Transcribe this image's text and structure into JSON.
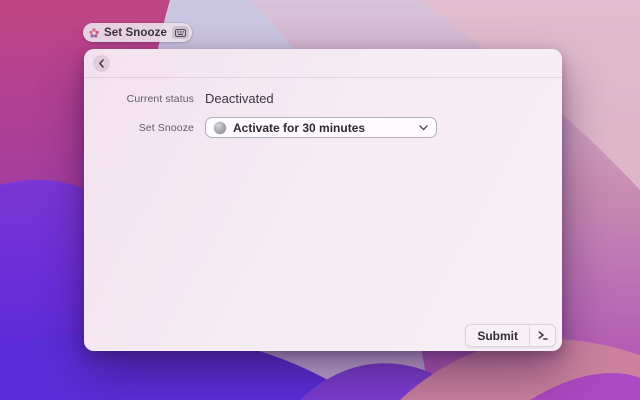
{
  "menubar_pill": {
    "label": "Set Snooze"
  },
  "window": {
    "form": {
      "rows": [
        {
          "label": "Current status",
          "value": "Deactivated"
        },
        {
          "label": "Set Snooze",
          "value": "Activate for 30 minutes"
        }
      ]
    },
    "footer": {
      "submit_label": "Submit"
    }
  },
  "icons": {
    "pill_app_icon": "snooze-flower-icon",
    "pill_keyboard_icon": "keyboard-icon",
    "back": "chevron-left-icon",
    "dropdown_item": "moon-icon",
    "dropdown_chevron": "chevron-down-icon",
    "submit_shortcut": "enter-key-icon"
  },
  "colors": {
    "window_bg": "#f4ebf3",
    "wall_violet": "#5b2dd9",
    "wall_magenta": "#b04a92",
    "wall_rose": "#c98fb2",
    "wall_lavender": "#cbc7e2",
    "dropdown_bg": "#fdfbfd",
    "dropdown_border": "#b4aeb8"
  }
}
